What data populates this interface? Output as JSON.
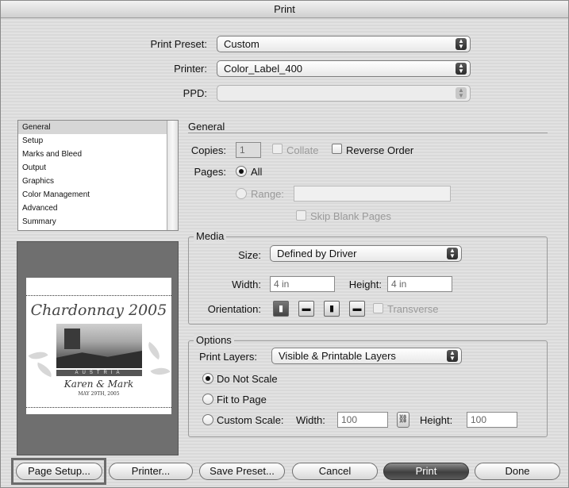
{
  "window": {
    "title": "Print"
  },
  "top": {
    "print_preset_label": "Print Preset:",
    "print_preset_value": "Custom",
    "printer_label": "Printer:",
    "printer_value": "Color_Label_400",
    "ppd_label": "PPD:",
    "ppd_value": ""
  },
  "sidebar": {
    "items": [
      {
        "label": "General",
        "selected": true
      },
      {
        "label": "Setup"
      },
      {
        "label": "Marks and Bleed"
      },
      {
        "label": "Output"
      },
      {
        "label": "Graphics"
      },
      {
        "label": "Color Management"
      },
      {
        "label": "Advanced"
      },
      {
        "label": "Summary"
      }
    ]
  },
  "preview": {
    "title": "Chardonnay 2005",
    "band": "AUSTRIA",
    "names": "Karen & Mark",
    "date": "MAY 29TH, 2005"
  },
  "general": {
    "heading": "General",
    "copies_label": "Copies:",
    "copies_value": "1",
    "collate_label": "Collate",
    "reverse_order_label": "Reverse Order",
    "pages_label": "Pages:",
    "all_label": "All",
    "range_label": "Range:",
    "range_value": "",
    "skip_blank_label": "Skip Blank Pages"
  },
  "media": {
    "legend": "Media",
    "size_label": "Size:",
    "size_value": "Defined by Driver",
    "width_label": "Width:",
    "width_value": "4 in",
    "height_label": "Height:",
    "height_value": "4 in",
    "orientation_label": "Orientation:",
    "transverse_label": "Transverse"
  },
  "options": {
    "legend": "Options",
    "print_layers_label": "Print Layers:",
    "print_layers_value": "Visible & Printable Layers",
    "do_not_scale_label": "Do Not Scale",
    "fit_to_page_label": "Fit to Page",
    "custom_scale_label": "Custom Scale:",
    "width_label": "Width:",
    "width_value": "100",
    "height_label": "Height:",
    "height_value": "100"
  },
  "buttons": {
    "page_setup": "Page Setup...",
    "printer": "Printer...",
    "save_preset": "Save Preset...",
    "cancel": "Cancel",
    "print": "Print",
    "done": "Done"
  },
  "icons": {
    "popup_arrows": "updown-arrows-icon",
    "orientation": [
      "portrait-icon",
      "landscape-icon",
      "reverse-portrait-icon",
      "reverse-landscape-icon"
    ],
    "link": "chain-link-icon"
  }
}
